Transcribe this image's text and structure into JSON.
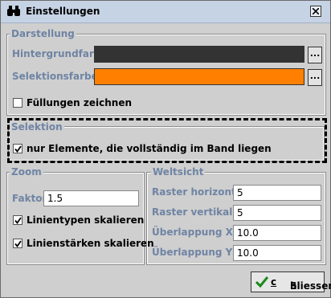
{
  "window": {
    "title": "Einstellungen",
    "close_symbol": "×"
  },
  "darstellung": {
    "legend": "Darstellung",
    "background_label": "Hintergrundfarbe",
    "background_color": "#333333",
    "selection_label": "Selektionsfarbe",
    "selection_color": "#ff8000",
    "dots_label": "...",
    "fill_checkbox_label": "Füllungen zeichnen",
    "fill_checked": false
  },
  "selektion": {
    "legend": "Selektion",
    "checkbox_label": "nur Elemente, die vollständig im Band liegen",
    "checked": true
  },
  "zoom": {
    "legend": "Zoom",
    "faktor_label": "Faktor",
    "faktor_value": "1.5",
    "linetypes_label": "Linientypen skalieren",
    "linetypes_checked": true,
    "linewidths_label": "Linienstärken skalieren",
    "linewidths_checked": true
  },
  "weltsicht": {
    "legend": "Weltsicht",
    "raster_h_label": "Raster horizontal",
    "raster_h_value": "5",
    "raster_v_label": "Raster vertikal",
    "raster_v_value": "5",
    "overlap_x_label": "Überlappung X",
    "overlap_x_value": "10.0",
    "overlap_y_label": "Überlappung Y",
    "overlap_y_value": "10.0"
  },
  "footer": {
    "close_button_prefix": "S",
    "close_button_mnemonic": "c",
    "close_button_rest": "hliessen"
  },
  "icons": {
    "title": "binoculars-icon",
    "confirm": "checkmark-icon"
  }
}
